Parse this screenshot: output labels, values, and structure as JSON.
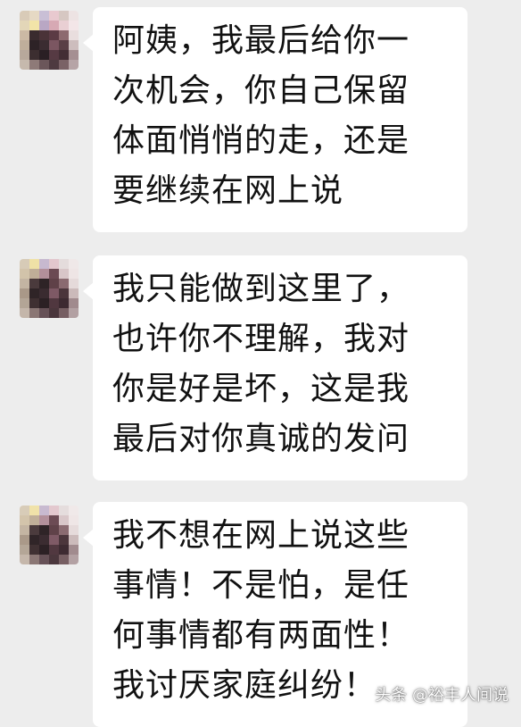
{
  "conversation": {
    "messages": [
      {
        "lines": [
          "阿姨，我最后给你一",
          "次机会，你自己保留",
          "体面悄悄的走，还是",
          "要继续在网上说"
        ]
      },
      {
        "lines": [
          "我只能做到这里了，",
          "也许你不理解，我对",
          "你是好是坏，这是我",
          "最后对你真诚的发问"
        ]
      },
      {
        "lines": [
          "我不想在网上说这些",
          "事情！不是怕，是任",
          "何事情都有两面性！",
          "我讨厌家庭纠纷！"
        ]
      }
    ]
  },
  "watermark": {
    "text": "头条 @裕丰人间说"
  },
  "colors": {
    "background": "#ededed",
    "bubble": "#ffffff",
    "text": "#111111"
  }
}
